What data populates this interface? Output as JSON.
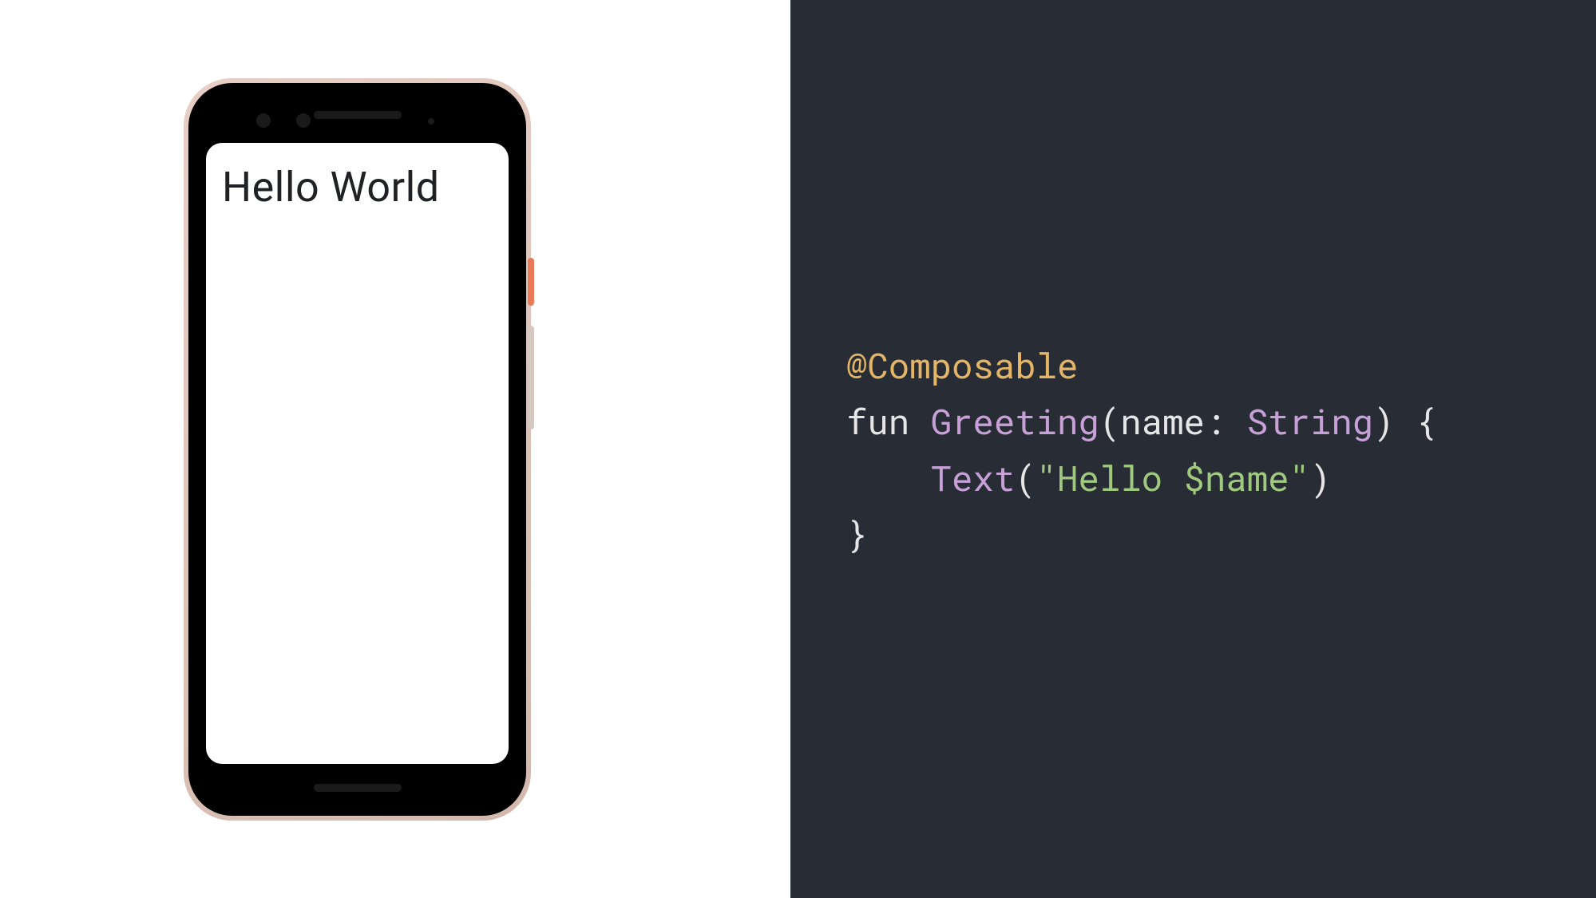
{
  "phone": {
    "greeting": "Hello World"
  },
  "code": {
    "annotation": "@Composable",
    "keyword_fun": "fun ",
    "func_name": "Greeting",
    "open_paren": "(",
    "param_name": "name",
    "colon_space": ": ",
    "type_name": "String",
    "close_paren_brace": ") {",
    "indent": "    ",
    "call_name": "Text",
    "call_open": "(",
    "string_literal": "\"Hello $name\"",
    "call_close": ")",
    "close_brace": "}"
  }
}
